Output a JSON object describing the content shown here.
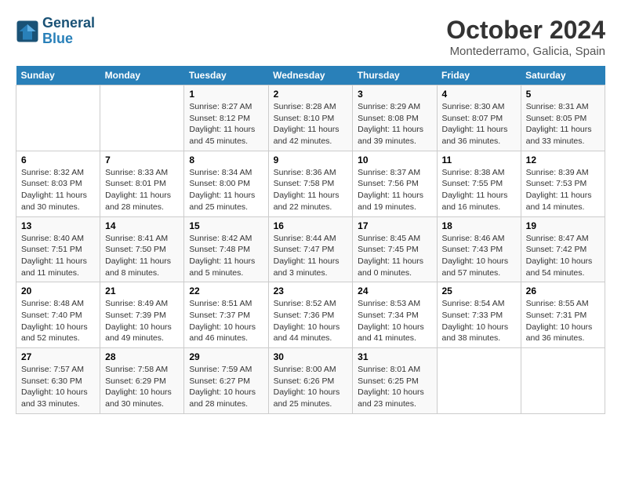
{
  "header": {
    "logo_line1": "General",
    "logo_line2": "Blue",
    "month": "October 2024",
    "location": "Montederramo, Galicia, Spain"
  },
  "days_of_week": [
    "Sunday",
    "Monday",
    "Tuesday",
    "Wednesday",
    "Thursday",
    "Friday",
    "Saturday"
  ],
  "weeks": [
    [
      {
        "day": "",
        "sunrise": "",
        "sunset": "",
        "daylight": ""
      },
      {
        "day": "",
        "sunrise": "",
        "sunset": "",
        "daylight": ""
      },
      {
        "day": "1",
        "sunrise": "Sunrise: 8:27 AM",
        "sunset": "Sunset: 8:12 PM",
        "daylight": "Daylight: 11 hours and 45 minutes."
      },
      {
        "day": "2",
        "sunrise": "Sunrise: 8:28 AM",
        "sunset": "Sunset: 8:10 PM",
        "daylight": "Daylight: 11 hours and 42 minutes."
      },
      {
        "day": "3",
        "sunrise": "Sunrise: 8:29 AM",
        "sunset": "Sunset: 8:08 PM",
        "daylight": "Daylight: 11 hours and 39 minutes."
      },
      {
        "day": "4",
        "sunrise": "Sunrise: 8:30 AM",
        "sunset": "Sunset: 8:07 PM",
        "daylight": "Daylight: 11 hours and 36 minutes."
      },
      {
        "day": "5",
        "sunrise": "Sunrise: 8:31 AM",
        "sunset": "Sunset: 8:05 PM",
        "daylight": "Daylight: 11 hours and 33 minutes."
      }
    ],
    [
      {
        "day": "6",
        "sunrise": "Sunrise: 8:32 AM",
        "sunset": "Sunset: 8:03 PM",
        "daylight": "Daylight: 11 hours and 30 minutes."
      },
      {
        "day": "7",
        "sunrise": "Sunrise: 8:33 AM",
        "sunset": "Sunset: 8:01 PM",
        "daylight": "Daylight: 11 hours and 28 minutes."
      },
      {
        "day": "8",
        "sunrise": "Sunrise: 8:34 AM",
        "sunset": "Sunset: 8:00 PM",
        "daylight": "Daylight: 11 hours and 25 minutes."
      },
      {
        "day": "9",
        "sunrise": "Sunrise: 8:36 AM",
        "sunset": "Sunset: 7:58 PM",
        "daylight": "Daylight: 11 hours and 22 minutes."
      },
      {
        "day": "10",
        "sunrise": "Sunrise: 8:37 AM",
        "sunset": "Sunset: 7:56 PM",
        "daylight": "Daylight: 11 hours and 19 minutes."
      },
      {
        "day": "11",
        "sunrise": "Sunrise: 8:38 AM",
        "sunset": "Sunset: 7:55 PM",
        "daylight": "Daylight: 11 hours and 16 minutes."
      },
      {
        "day": "12",
        "sunrise": "Sunrise: 8:39 AM",
        "sunset": "Sunset: 7:53 PM",
        "daylight": "Daylight: 11 hours and 14 minutes."
      }
    ],
    [
      {
        "day": "13",
        "sunrise": "Sunrise: 8:40 AM",
        "sunset": "Sunset: 7:51 PM",
        "daylight": "Daylight: 11 hours and 11 minutes."
      },
      {
        "day": "14",
        "sunrise": "Sunrise: 8:41 AM",
        "sunset": "Sunset: 7:50 PM",
        "daylight": "Daylight: 11 hours and 8 minutes."
      },
      {
        "day": "15",
        "sunrise": "Sunrise: 8:42 AM",
        "sunset": "Sunset: 7:48 PM",
        "daylight": "Daylight: 11 hours and 5 minutes."
      },
      {
        "day": "16",
        "sunrise": "Sunrise: 8:44 AM",
        "sunset": "Sunset: 7:47 PM",
        "daylight": "Daylight: 11 hours and 3 minutes."
      },
      {
        "day": "17",
        "sunrise": "Sunrise: 8:45 AM",
        "sunset": "Sunset: 7:45 PM",
        "daylight": "Daylight: 11 hours and 0 minutes."
      },
      {
        "day": "18",
        "sunrise": "Sunrise: 8:46 AM",
        "sunset": "Sunset: 7:43 PM",
        "daylight": "Daylight: 10 hours and 57 minutes."
      },
      {
        "day": "19",
        "sunrise": "Sunrise: 8:47 AM",
        "sunset": "Sunset: 7:42 PM",
        "daylight": "Daylight: 10 hours and 54 minutes."
      }
    ],
    [
      {
        "day": "20",
        "sunrise": "Sunrise: 8:48 AM",
        "sunset": "Sunset: 7:40 PM",
        "daylight": "Daylight: 10 hours and 52 minutes."
      },
      {
        "day": "21",
        "sunrise": "Sunrise: 8:49 AM",
        "sunset": "Sunset: 7:39 PM",
        "daylight": "Daylight: 10 hours and 49 minutes."
      },
      {
        "day": "22",
        "sunrise": "Sunrise: 8:51 AM",
        "sunset": "Sunset: 7:37 PM",
        "daylight": "Daylight: 10 hours and 46 minutes."
      },
      {
        "day": "23",
        "sunrise": "Sunrise: 8:52 AM",
        "sunset": "Sunset: 7:36 PM",
        "daylight": "Daylight: 10 hours and 44 minutes."
      },
      {
        "day": "24",
        "sunrise": "Sunrise: 8:53 AM",
        "sunset": "Sunset: 7:34 PM",
        "daylight": "Daylight: 10 hours and 41 minutes."
      },
      {
        "day": "25",
        "sunrise": "Sunrise: 8:54 AM",
        "sunset": "Sunset: 7:33 PM",
        "daylight": "Daylight: 10 hours and 38 minutes."
      },
      {
        "day": "26",
        "sunrise": "Sunrise: 8:55 AM",
        "sunset": "Sunset: 7:31 PM",
        "daylight": "Daylight: 10 hours and 36 minutes."
      }
    ],
    [
      {
        "day": "27",
        "sunrise": "Sunrise: 7:57 AM",
        "sunset": "Sunset: 6:30 PM",
        "daylight": "Daylight: 10 hours and 33 minutes."
      },
      {
        "day": "28",
        "sunrise": "Sunrise: 7:58 AM",
        "sunset": "Sunset: 6:29 PM",
        "daylight": "Daylight: 10 hours and 30 minutes."
      },
      {
        "day": "29",
        "sunrise": "Sunrise: 7:59 AM",
        "sunset": "Sunset: 6:27 PM",
        "daylight": "Daylight: 10 hours and 28 minutes."
      },
      {
        "day": "30",
        "sunrise": "Sunrise: 8:00 AM",
        "sunset": "Sunset: 6:26 PM",
        "daylight": "Daylight: 10 hours and 25 minutes."
      },
      {
        "day": "31",
        "sunrise": "Sunrise: 8:01 AM",
        "sunset": "Sunset: 6:25 PM",
        "daylight": "Daylight: 10 hours and 23 minutes."
      },
      {
        "day": "",
        "sunrise": "",
        "sunset": "",
        "daylight": ""
      },
      {
        "day": "",
        "sunrise": "",
        "sunset": "",
        "daylight": ""
      }
    ]
  ]
}
